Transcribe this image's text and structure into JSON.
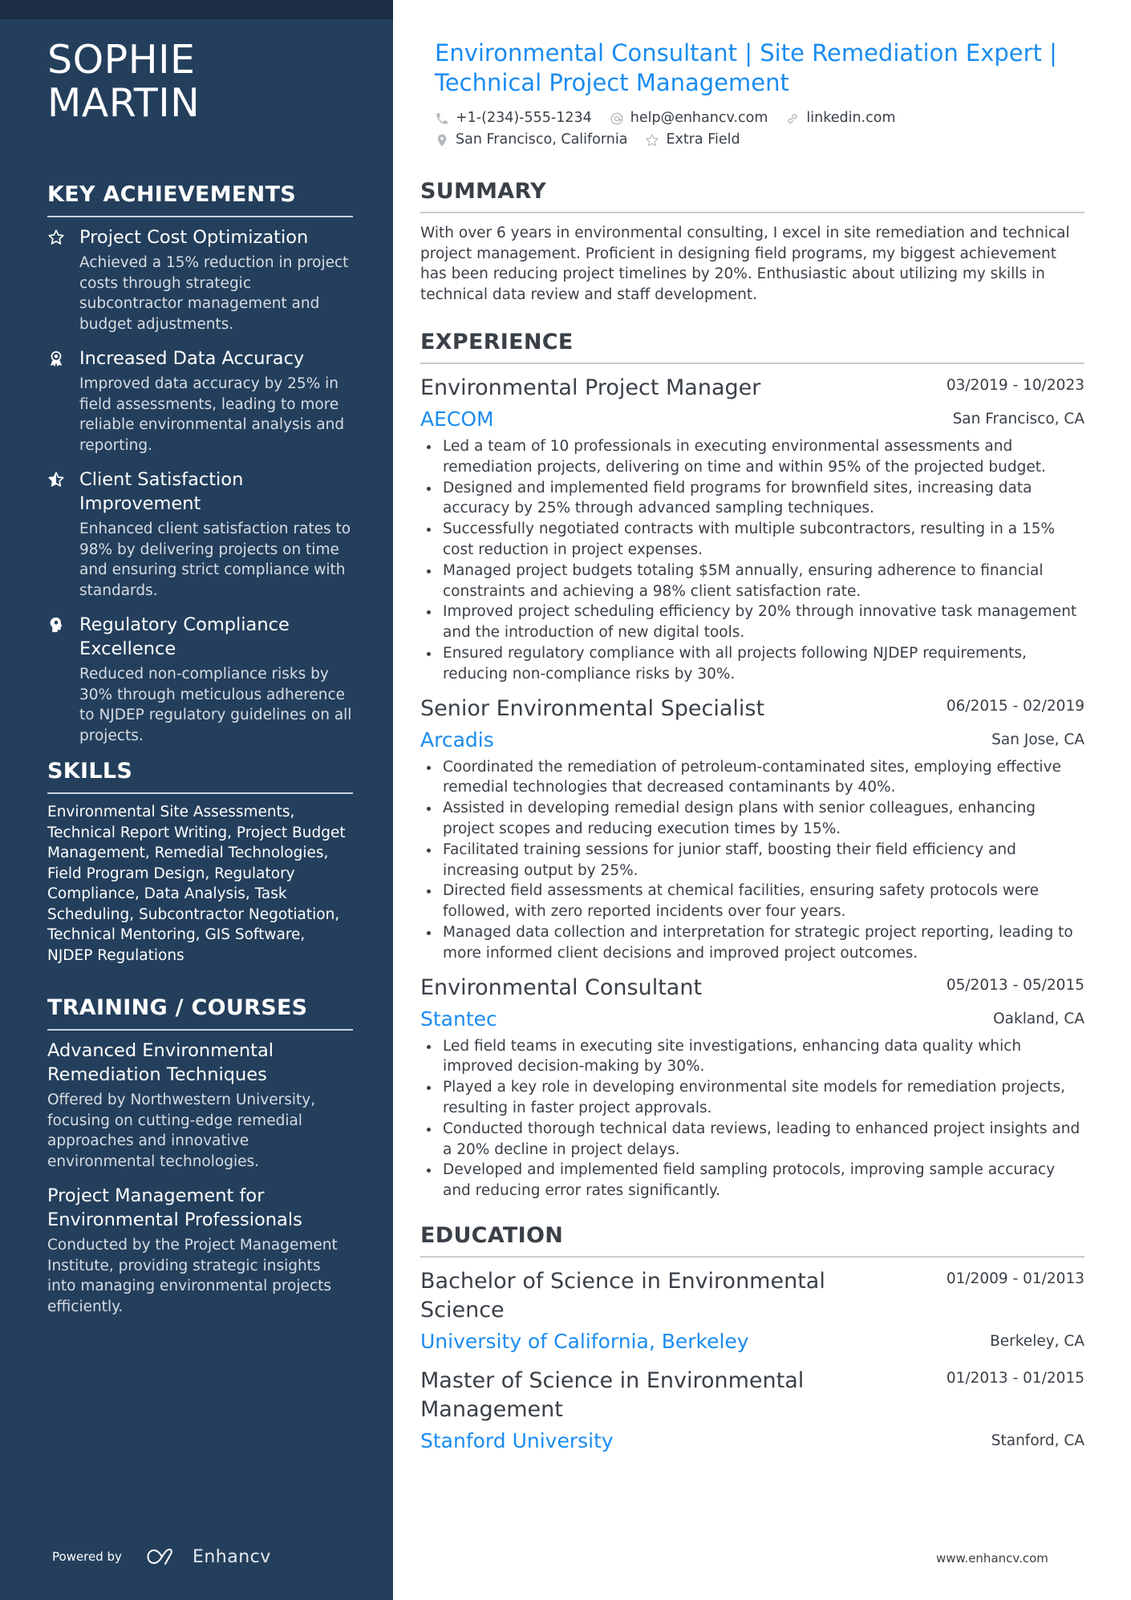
{
  "sidebar": {
    "name_line1": "SOPHIE",
    "name_line2": "MARTIN",
    "achievements_title": "KEY ACHIEVEMENTS",
    "achievements": [
      {
        "icon": "star-outline-icon",
        "title": "Project Cost Optimization",
        "desc": "Achieved a 15% reduction in project costs through strategic subcontractor management and budget adjustments."
      },
      {
        "icon": "award-ribbon-icon",
        "title": "Increased Data Accuracy",
        "desc": "Improved data accuracy by 25% in field assessments, leading to more reliable environmental analysis and reporting."
      },
      {
        "icon": "star-half-icon",
        "title": "Client Satisfaction Improvement",
        "desc": "Enhanced client satisfaction rates to 98% by delivering projects on time and ensuring strict compliance with standards."
      },
      {
        "icon": "head-brain-icon",
        "title": "Regulatory Compliance Excellence",
        "desc": "Reduced non-compliance risks by 30% through meticulous adherence to NJDEP regulatory guidelines on all projects."
      }
    ],
    "skills_title": "SKILLS",
    "skills_text": "Environmental Site Assessments, Technical Report Writing, Project Budget Management, Remedial Technologies, Field Program Design, Regulatory Compliance, Data Analysis, Task Scheduling, Subcontractor Negotiation, Technical Mentoring, GIS Software, NJDEP Regulations",
    "training_title": "TRAINING / COURSES",
    "courses": [
      {
        "title": "Advanced Environmental Remediation Techniques",
        "desc": "Offered by Northwestern University, focusing on cutting-edge remedial approaches and innovative environmental technologies."
      },
      {
        "title": "Project Management for Environmental Professionals",
        "desc": "Conducted by the Project Management Institute, providing strategic insights into managing environmental projects efficiently."
      }
    ],
    "powered_by": "Powered by",
    "brand": "Enhancv"
  },
  "header": {
    "headline": "Environmental Consultant | Site Remediation Expert | Technical Project Management",
    "phone": "+1-(234)-555-1234",
    "email": "help@enhancv.com",
    "linkedin": "linkedin.com",
    "location": "San Francisco, California",
    "extra": "Extra Field"
  },
  "summary": {
    "title": "SUMMARY",
    "text": "With over 6 years in environmental consulting, I excel in site remediation and technical project management. Proficient in designing field programs, my biggest achievement has been reducing project timelines by 20%. Enthusiastic about utilizing my skills in technical data review and staff development."
  },
  "experience": {
    "title": "EXPERIENCE",
    "jobs": [
      {
        "title": "Environmental Project Manager",
        "dates": "03/2019 - 10/2023",
        "company": "AECOM",
        "location": "San Francisco, CA",
        "bullets": [
          "Led a team of 10 professionals in executing environmental assessments and remediation projects, delivering on time and within 95% of the projected budget.",
          "Designed and implemented field programs for brownfield sites, increasing data accuracy by 25% through advanced sampling techniques.",
          "Successfully negotiated contracts with multiple subcontractors, resulting in a 15% cost reduction in project expenses.",
          "Managed project budgets totaling $5M annually, ensuring adherence to financial constraints and achieving a 98% client satisfaction rate.",
          "Improved project scheduling efficiency by 20% through innovative task management and the introduction of new digital tools.",
          "Ensured regulatory compliance with all projects following NJDEP requirements, reducing non-compliance risks by 30%."
        ]
      },
      {
        "title": "Senior Environmental Specialist",
        "dates": "06/2015 - 02/2019",
        "company": "Arcadis",
        "location": "San Jose, CA",
        "bullets": [
          "Coordinated the remediation of petroleum-contaminated sites, employing effective remedial technologies that decreased contaminants by 40%.",
          "Assisted in developing remedial design plans with senior colleagues, enhancing project scopes and reducing execution times by 15%.",
          "Facilitated training sessions for junior staff, boosting their field efficiency and increasing output by 25%.",
          "Directed field assessments at chemical facilities, ensuring safety protocols were followed, with zero reported incidents over four years.",
          "Managed data collection and interpretation for strategic project reporting, leading to more informed client decisions and improved project outcomes."
        ]
      },
      {
        "title": "Environmental Consultant",
        "dates": "05/2013 - 05/2015",
        "company": "Stantec",
        "location": "Oakland, CA",
        "bullets": [
          "Led field teams in executing site investigations, enhancing data quality which improved decision-making by 30%.",
          "Played a key role in developing environmental site models for remediation projects, resulting in faster project approvals.",
          "Conducted thorough technical data reviews, leading to enhanced project insights and a 20% decline in project delays.",
          "Developed and implemented field sampling protocols, improving sample accuracy and reducing error rates significantly."
        ]
      }
    ]
  },
  "education": {
    "title": "EDUCATION",
    "items": [
      {
        "degree": "Bachelor of Science in Environmental Science",
        "dates": "01/2009 - 01/2013",
        "school": "University of California, Berkeley",
        "location": "Berkeley, CA"
      },
      {
        "degree": "Master of Science in Environmental Management",
        "dates": "01/2013 - 01/2015",
        "school": "Stanford University",
        "location": "Stanford, CA"
      }
    ]
  },
  "footer": {
    "url": "www.enhancv.com"
  },
  "colors": {
    "sidebar_bg": "#243f5c",
    "sidebar_topband": "#1c2e45",
    "accent": "#1a8cf0",
    "body_text": "#3a4047"
  }
}
